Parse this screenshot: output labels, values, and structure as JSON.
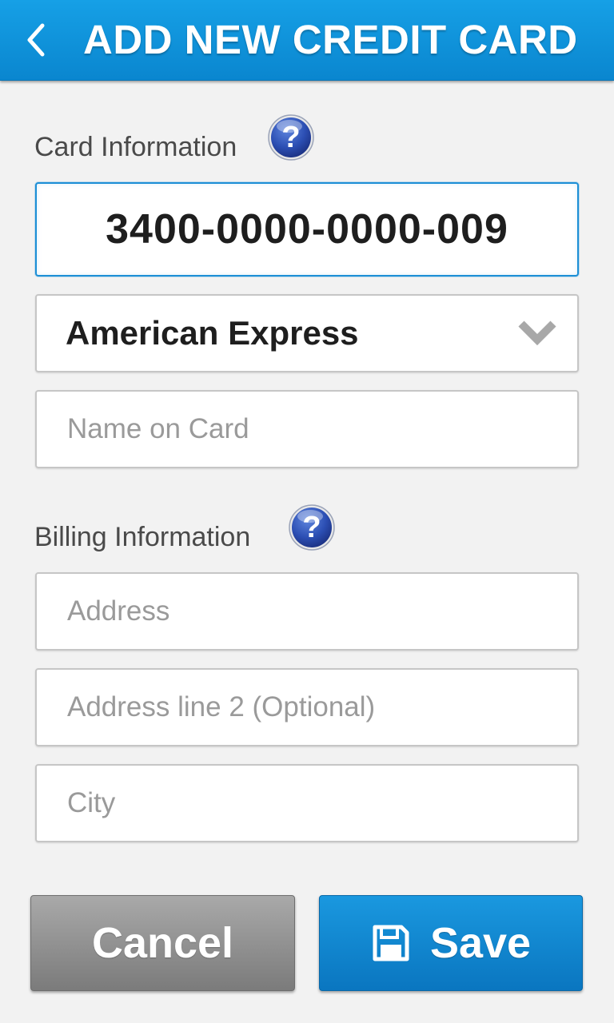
{
  "header": {
    "title": "ADD NEW CREDIT CARD",
    "back_icon": "chevron-left-icon"
  },
  "card_section": {
    "label": "Card Information",
    "help_icon": "help-icon",
    "card_number": "3400-0000-0000-009",
    "card_type": "American Express",
    "name_placeholder": "Name on Card"
  },
  "billing_section": {
    "label": "Billing Information",
    "help_icon": "help-icon",
    "address_placeholder": "Address",
    "address2_placeholder": "Address line 2 (Optional)",
    "city_placeholder": "City"
  },
  "actions": {
    "cancel_label": "Cancel",
    "save_label": "Save",
    "save_icon": "floppy-disk-icon"
  },
  "colors": {
    "accent": "#0a86cf",
    "cancel": "#8e8e8e",
    "background": "#f2f2f2"
  }
}
